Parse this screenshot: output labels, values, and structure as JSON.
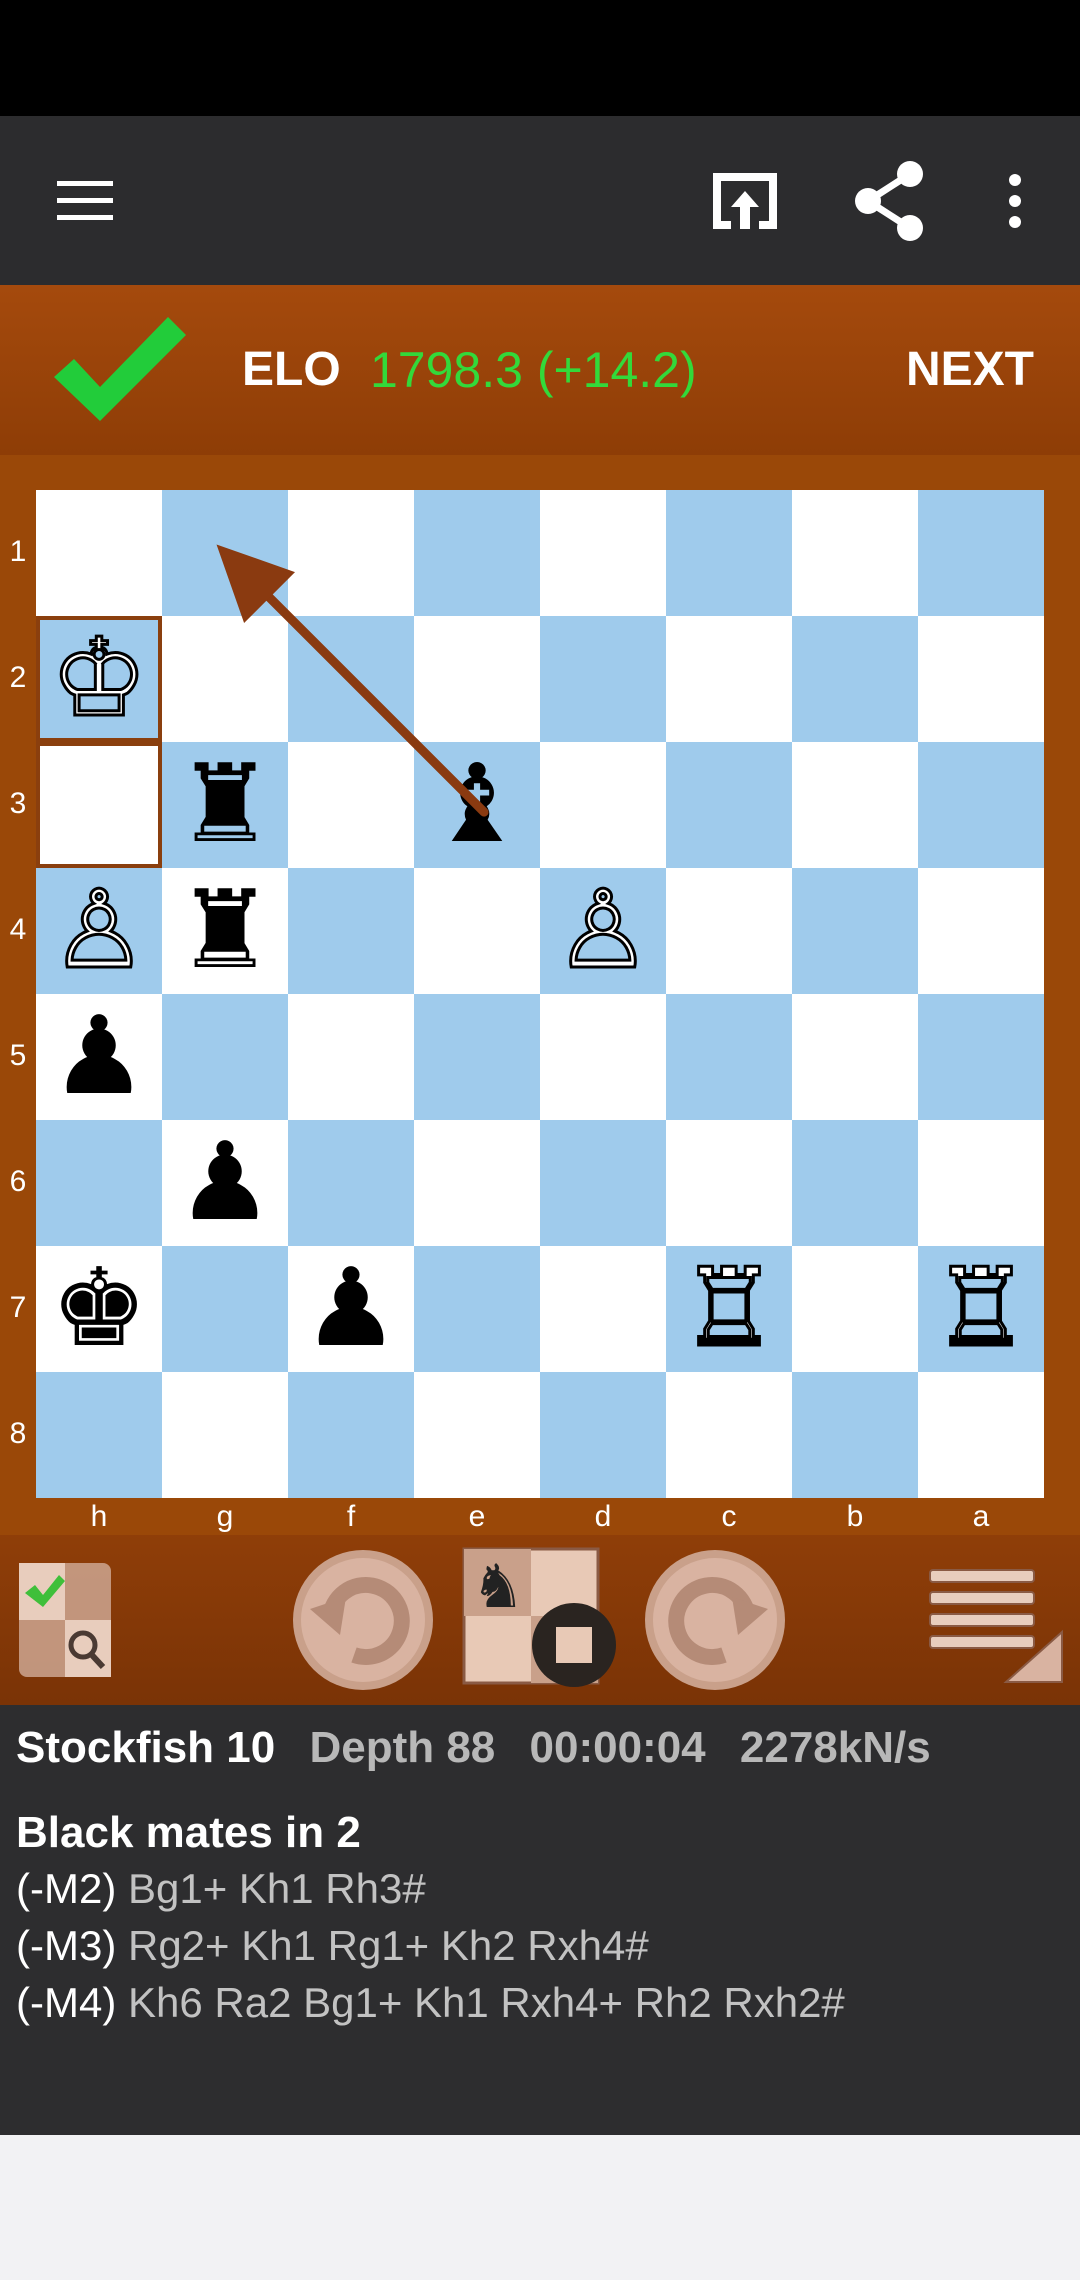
{
  "toolbar": {
    "menu_icon": "hamburger-menu-icon",
    "icons": [
      "open-external-icon",
      "share-icon",
      "more-vert-icon"
    ]
  },
  "banner": {
    "status_icon": "check-icon",
    "elo_label": "ELO",
    "elo_value": "1798.3 (+14.2)",
    "next_label": "NEXT",
    "colors": {
      "elo_value": "#33d93a",
      "check": "#22cc3a"
    }
  },
  "board": {
    "ranks": [
      "1",
      "2",
      "3",
      "4",
      "5",
      "6",
      "7",
      "8"
    ],
    "files": [
      "h",
      "g",
      "f",
      "e",
      "d",
      "c",
      "b",
      "a"
    ],
    "colors": {
      "light": "#ffffff",
      "dark": "#9fcbec",
      "frame": "#9a4808",
      "arrow": "#8a3a10"
    },
    "pieces": [
      {
        "square": "h2",
        "glyph": "♔",
        "color": "white"
      },
      {
        "square": "g3",
        "glyph": "♜",
        "color": "black"
      },
      {
        "square": "e3",
        "glyph": "♝",
        "color": "black"
      },
      {
        "square": "h4",
        "glyph": "♙",
        "color": "white"
      },
      {
        "square": "g4",
        "glyph": "♜",
        "color": "black"
      },
      {
        "square": "d4",
        "glyph": "♙",
        "color": "white"
      },
      {
        "square": "h5",
        "glyph": "♟",
        "color": "black"
      },
      {
        "square": "g6",
        "glyph": "♟",
        "color": "black"
      },
      {
        "square": "h7",
        "glyph": "♚",
        "color": "black"
      },
      {
        "square": "f7",
        "glyph": "♟",
        "color": "black"
      },
      {
        "square": "c7",
        "glyph": "♖",
        "color": "white"
      },
      {
        "square": "a7",
        "glyph": "♖",
        "color": "white"
      }
    ],
    "highlight": [
      "h2",
      "h3"
    ],
    "arrow": {
      "from": "e3",
      "to": "g1"
    }
  },
  "controls": [
    "mode-toggle-icon",
    "undo-icon",
    "play-mode-icon",
    "redo-icon",
    "move-list-icon"
  ],
  "engine": {
    "name": "Stockfish 10",
    "depth": "Depth 88",
    "time": "00:00:04",
    "speed": "2278kN/s",
    "summary": "Black mates in 2",
    "lines": [
      {
        "score": "(-M2)",
        "moves": "Bg1+ Kh1 Rh3#"
      },
      {
        "score": "(-M3)",
        "moves": "Rg2+ Kh1 Rg1+ Kh2 Rxh4#"
      },
      {
        "score": "(-M4)",
        "moves": "Kh6 Ra2 Bg1+ Kh1 Rxh4+ Rh2 Rxh2#"
      }
    ]
  }
}
